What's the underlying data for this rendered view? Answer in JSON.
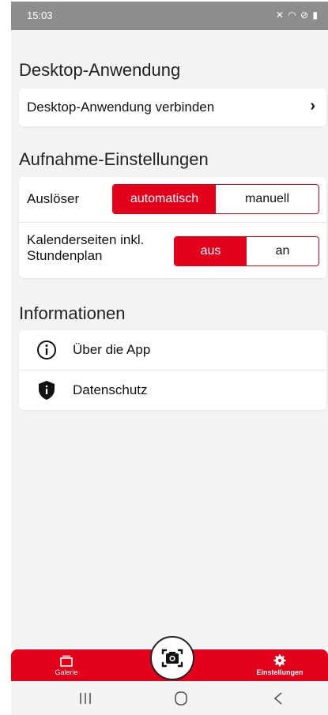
{
  "status_bar": {
    "time": "15:03",
    "icons": "✕ ◠ ⊘ ▮"
  },
  "desktop": {
    "title": "Desktop-Anwendung",
    "connect_label": "Desktop-Anwendung verbinden"
  },
  "recording": {
    "title": "Aufnahme-Einstellungen",
    "trigger": {
      "label": "Auslöser",
      "options": [
        "automatisch",
        "manuell"
      ],
      "selected": "automatisch"
    },
    "calendar": {
      "label_line1": "Kalenderseiten inkl.",
      "label_line2": "Stundenplan",
      "options": [
        "aus",
        "an"
      ],
      "selected": "aus"
    }
  },
  "info": {
    "title": "Informationen",
    "items": [
      {
        "label": "Über die App",
        "icon": "info-icon"
      },
      {
        "label": "Datenschutz",
        "icon": "shield-icon"
      }
    ]
  },
  "tabbar": {
    "gallery_label": "Galerie",
    "settings_label": "Einstellungen",
    "active": "Einstellungen"
  },
  "colors": {
    "accent": "#e2001a",
    "background": "#f3f3f3",
    "card": "#ffffff"
  }
}
